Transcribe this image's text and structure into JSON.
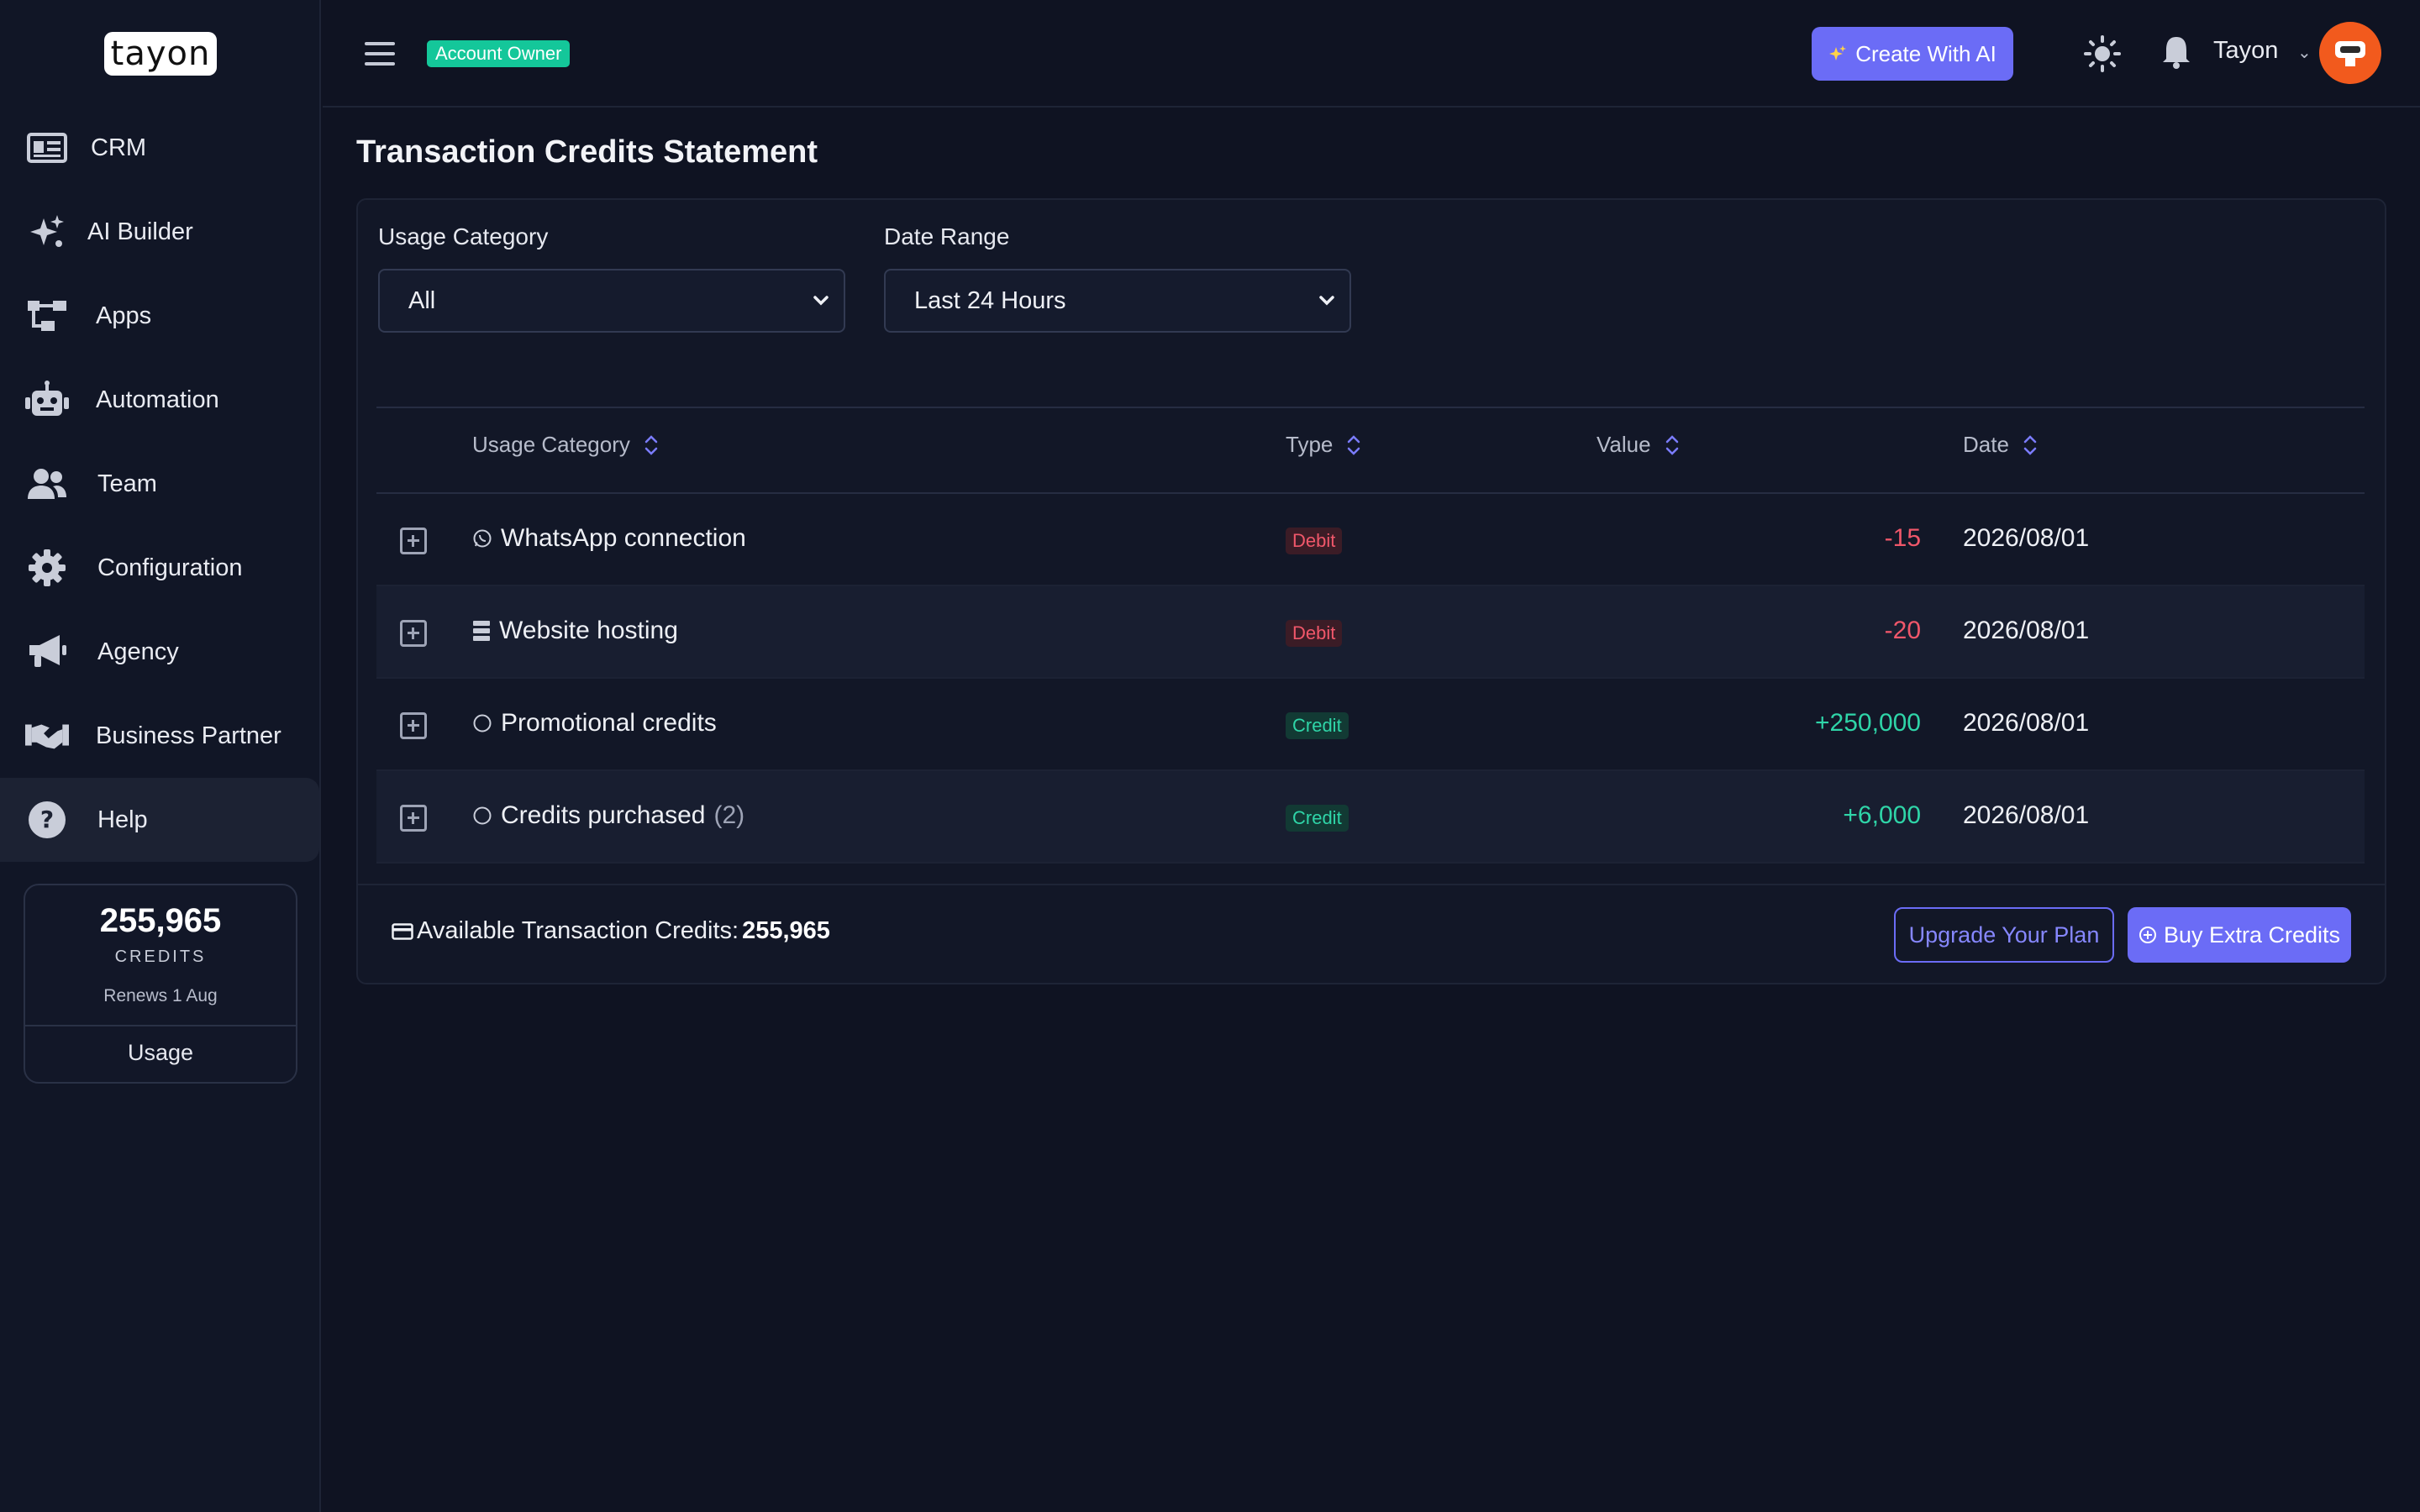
{
  "brand": {
    "logo_text": "tayon"
  },
  "sidebar": {
    "items": [
      {
        "label": "CRM",
        "icon": "id-card-icon"
      },
      {
        "label": "AI Builder",
        "icon": "sparkles-icon"
      },
      {
        "label": "Apps",
        "icon": "apps-flow-icon"
      },
      {
        "label": "Automation",
        "icon": "robot-icon"
      },
      {
        "label": "Team",
        "icon": "users-icon"
      },
      {
        "label": "Configuration",
        "icon": "gear-icon"
      },
      {
        "label": "Agency",
        "icon": "megaphone-icon"
      },
      {
        "label": "Business Partner",
        "icon": "handshake-icon"
      },
      {
        "label": "Help",
        "icon": "help-circle-icon",
        "active": true
      }
    ],
    "credits": {
      "amount": "255,965",
      "caption": "CREDITS",
      "renews": "Renews 1 Aug",
      "usage_label": "Usage"
    }
  },
  "topbar": {
    "role_badge": "Account Owner",
    "create_ai_label": "Create With AI",
    "user_name": "Tayon"
  },
  "page": {
    "title": "Transaction Credits Statement",
    "filters": {
      "usage_category_label": "Usage Category",
      "usage_category_value": "All",
      "date_range_label": "Date Range",
      "date_range_value": "Last 24 Hours"
    },
    "table": {
      "headers": {
        "category": "Usage Category",
        "type": "Type",
        "value": "Value",
        "date": "Date"
      },
      "rows": [
        {
          "icon": "whatsapp-icon",
          "category": "WhatsApp connection",
          "count": "",
          "type": "Debit",
          "value": "-15",
          "date": "2026/08/01"
        },
        {
          "icon": "server-icon",
          "category": "Website hosting",
          "count": "",
          "type": "Debit",
          "value": "-20",
          "date": "2026/08/01"
        },
        {
          "icon": "circle-icon",
          "category": "Promotional credits",
          "count": "",
          "type": "Credit",
          "value": "+250,000",
          "date": "2026/08/01"
        },
        {
          "icon": "circle-icon",
          "category": "Credits purchased",
          "count": "(2)",
          "type": "Credit",
          "value": "+6,000",
          "date": "2026/08/01"
        }
      ]
    },
    "footer": {
      "available_label": "Available Transaction Credits:",
      "available_value": "255,965",
      "upgrade_label": "Upgrade Your Plan",
      "buy_label": "Buy Extra Credits"
    }
  },
  "colors": {
    "accent": "#6b6cf6",
    "debit": "#f0576a",
    "credit": "#2fd5a8",
    "background": "#0f1322",
    "avatar": "#f25a1d"
  }
}
